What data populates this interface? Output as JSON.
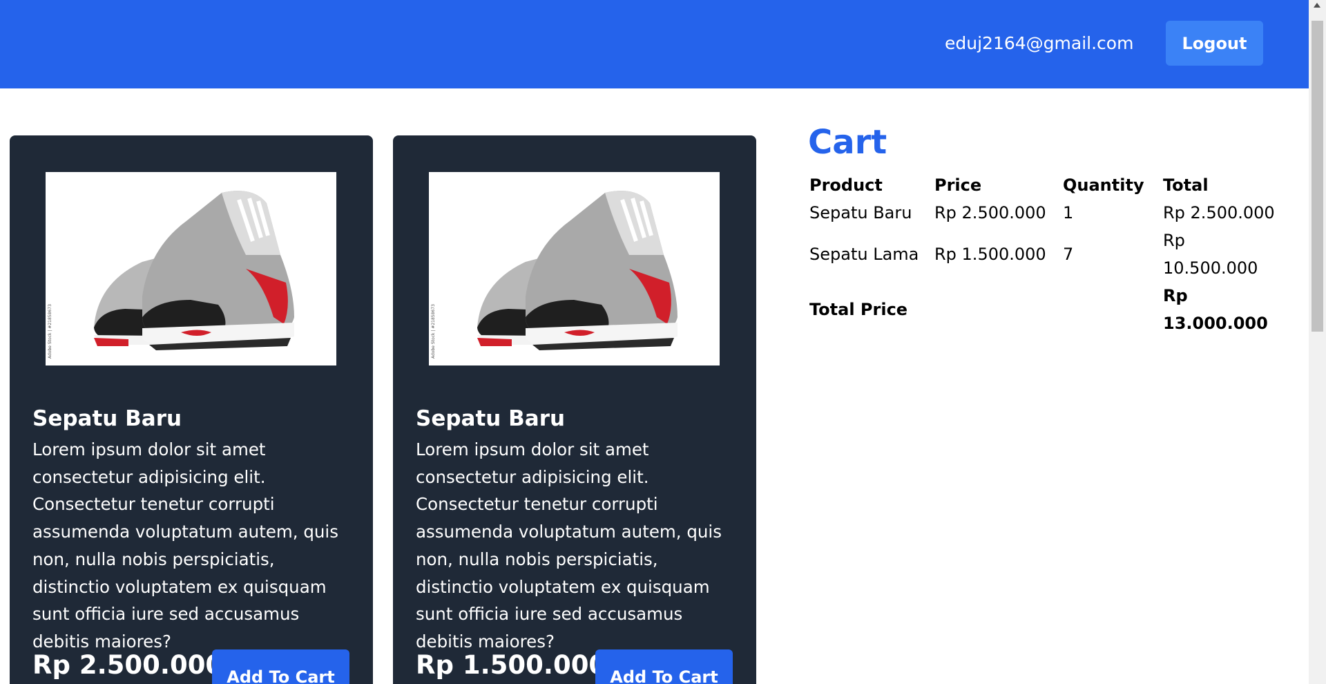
{
  "header": {
    "user_email": "eduj2164@gmail.com",
    "logout_label": "Logout"
  },
  "products": [
    {
      "title": "Sepatu Baru",
      "description": "Lorem ipsum dolor sit amet consectetur adipisicing elit. Consectetur tenetur corrupti assumenda voluptatum autem, quis non, nulla nobis perspiciatis, distinctio voluptatem ex quisquam sunt officia iure sed accusamus debitis maiores?",
      "price": "Rp 2.500.000",
      "button_label": "Add To Cart",
      "image_watermark": "Adobe Stock | #21858673"
    },
    {
      "title": "Sepatu Baru",
      "description": "Lorem ipsum dolor sit amet consectetur adipisicing elit. Consectetur tenetur corrupti assumenda voluptatum autem, quis non, nulla nobis perspiciatis, distinctio voluptatem ex quisquam sunt officia iure sed accusamus debitis maiores?",
      "price": "Rp 1.500.000",
      "button_label": "Add To Cart",
      "image_watermark": "Adobe Stock | #21858673"
    }
  ],
  "cart": {
    "title": "Cart",
    "columns": [
      "Product",
      "Price",
      "Quantity",
      "Total"
    ],
    "rows": [
      {
        "product": "Sepatu Baru",
        "price": "Rp 2.500.000",
        "quantity": "1",
        "total": "Rp 2.500.000"
      },
      {
        "product": "Sepatu Lama",
        "price": "Rp 1.500.000",
        "quantity": "7",
        "total": "Rp 10.500.000"
      }
    ],
    "total_label": "Total Price",
    "total_value": "Rp 13.000.000"
  },
  "colors": {
    "navbar": "#2563eb",
    "logout_button": "#3b82f6",
    "card_background": "#1f2937",
    "accent": "#2563eb"
  }
}
